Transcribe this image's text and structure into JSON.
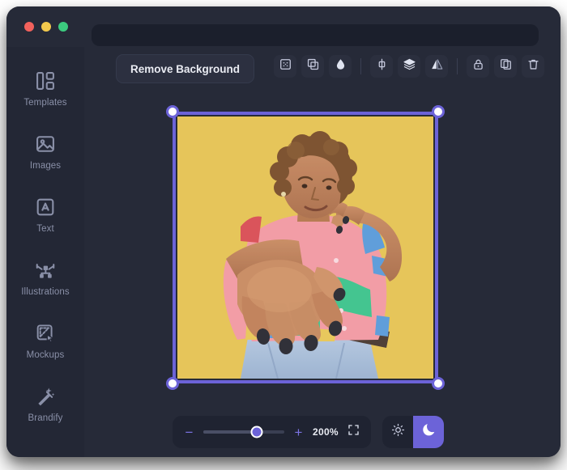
{
  "window": {
    "traffic_lights": [
      {
        "name": "close",
        "color": "#f2615c"
      },
      {
        "name": "minimize",
        "color": "#f3c94d"
      },
      {
        "name": "maximize",
        "color": "#3ccb7f"
      }
    ],
    "address_bar_value": "",
    "address_bar_placeholder": ""
  },
  "sidebar": {
    "items": [
      {
        "label": "Templates",
        "icon": "templates-icon"
      },
      {
        "label": "Images",
        "icon": "images-icon"
      },
      {
        "label": "Text",
        "icon": "text-icon"
      },
      {
        "label": "Illustrations",
        "icon": "illustrations-icon"
      },
      {
        "label": "Mockups",
        "icon": "mockups-icon"
      },
      {
        "label": "Brandify",
        "icon": "brandify-icon"
      }
    ]
  },
  "toolbar": {
    "remove_background_label": "Remove Background",
    "icons": [
      {
        "name": "crop-icon",
        "title": "Crop"
      },
      {
        "name": "duplicate-shape-icon",
        "title": "Duplicate shape"
      },
      {
        "name": "droplet-icon",
        "title": "Color"
      },
      {
        "name": "align-vertical-icon",
        "title": "Align vertical"
      },
      {
        "name": "layers-icon",
        "title": "Layers"
      },
      {
        "name": "flip-horizontal-icon",
        "title": "Flip"
      },
      {
        "name": "lock-icon",
        "title": "Lock"
      },
      {
        "name": "copy-icon",
        "title": "Copy"
      },
      {
        "name": "trash-icon",
        "title": "Delete"
      }
    ]
  },
  "canvas": {
    "selection_active": true,
    "selection_handles": [
      "top-left",
      "top-right",
      "bottom-left",
      "bottom-right"
    ],
    "selection_color": "#6c63d8",
    "photo": {
      "description": "Portrait of a person in front of a yellow backdrop, wearing a colorblock pink, green and blue shirt with light blue jeans, reaching one hand toward the camera",
      "background_color": "#e8c758",
      "shirt_colors": [
        "#f29aa4",
        "#3ec48d",
        "#5b9bd9",
        "#d94f56"
      ],
      "jeans_color": "#a9c0dd"
    }
  },
  "bottom_bar": {
    "zoom_out_label": "−",
    "zoom_in_label": "+",
    "zoom_value": "200%",
    "zoom_slider_percent": 66,
    "fit_icon": "fit-screen-icon",
    "theme": {
      "light_icon": "sun-icon",
      "dark_icon": "moon-icon",
      "active": "dark"
    }
  },
  "colors": {
    "window_bg": "#262a38",
    "sidebar_bg": "#232735",
    "panel_bg": "#1f2331",
    "accent": "#6c63d8",
    "text_muted": "#8a90a8",
    "text_primary": "#e9ebf2"
  }
}
